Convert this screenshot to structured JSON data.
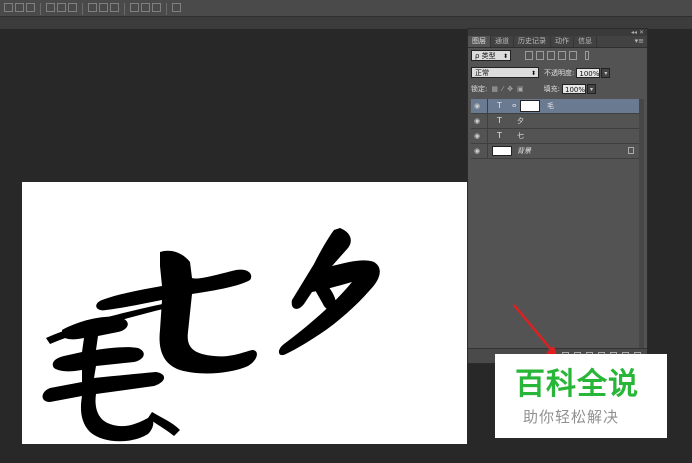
{
  "panel": {
    "tabs": [
      "图层",
      "通道",
      "历史记录",
      "动作",
      "信息"
    ],
    "filter_label": "ρ 类型",
    "blend_mode": "正常",
    "opacity_label": "不透明度:",
    "opacity_value": "100%",
    "lock_label": "锁定:",
    "fill_label": "填充:",
    "fill_value": "100%",
    "layers": [
      {
        "name": "毛",
        "type": "text",
        "selected": true,
        "has_mask": true
      },
      {
        "name": "夕",
        "type": "text",
        "selected": false
      },
      {
        "name": "七",
        "type": "text",
        "selected": false
      },
      {
        "name": "背景",
        "type": "image",
        "selected": false,
        "locked": true
      }
    ]
  },
  "watermark": {
    "title": "百科全说",
    "subtitle": "助你轻松解决"
  },
  "colors": {
    "workspace": "#282828",
    "panel": "#535353",
    "selected_layer": "#6a7a90",
    "watermark_green": "#27b637",
    "arrow_red": "#e02020"
  }
}
